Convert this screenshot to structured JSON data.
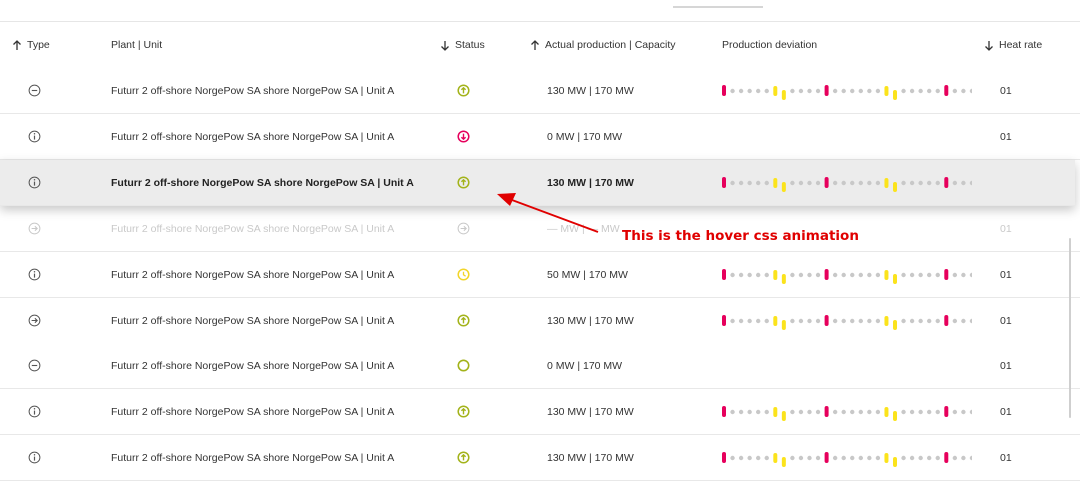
{
  "header": {
    "type": "Type",
    "plant_unit": "Plant | Unit",
    "status": "Status",
    "production": "Actual production | Capacity",
    "deviation": "Production deviation",
    "heat_rate": "Heat rate"
  },
  "rows": [
    {
      "type_icon": "minus-circle-icon",
      "plant": "Futurr 2 off-shore NorgePow SA shore NorgePow SA | Unit A",
      "status_icon": "arrow-up-circle-icon",
      "status_color": "#a3b31a",
      "production": "130 MW | 170 MW",
      "deviation": true,
      "heat_rate": "01"
    },
    {
      "type_icon": "info-circle-icon",
      "plant": "Futurr 2 off-shore NorgePow SA shore NorgePow SA | Unit A",
      "status_icon": "arrow-down-circle-icon",
      "status_color": "#e6005c",
      "production": "0 MW | 170 MW",
      "deviation": false,
      "heat_rate": "01"
    },
    {
      "type_icon": "info-circle-icon",
      "plant": "Futurr 2 off-shore NorgePow SA shore NorgePow SA | Unit A",
      "status_icon": "arrow-up-circle-icon",
      "status_color": "#a3b31a",
      "production": "130 MW | 170 MW",
      "deviation": true,
      "heat_rate": ""
    },
    {
      "type_icon": "arrow-right-circle-icon",
      "plant": "Futurr 2 off-shore NorgePow SA shore NorgePow SA | Unit A",
      "status_icon": "arrow-right-circle-icon",
      "status_color": "#c9c9c9",
      "production": "— MW | — MW",
      "deviation": false,
      "heat_rate": "01"
    },
    {
      "type_icon": "info-circle-icon",
      "plant": "Futurr 2 off-shore NorgePow SA shore NorgePow SA | Unit A",
      "status_icon": "clock-circle-icon",
      "status_color": "#f2d52a",
      "production": "50 MW | 170 MW",
      "deviation": true,
      "heat_rate": "01"
    },
    {
      "type_icon": "arrow-right-circle-icon",
      "plant": "Futurr 2 off-shore NorgePow SA shore NorgePow SA | Unit A",
      "status_icon": "arrow-up-circle-icon",
      "status_color": "#a3b31a",
      "production": "130 MW | 170 MW",
      "deviation": true,
      "heat_rate": "01"
    },
    {
      "type_icon": "minus-circle-icon",
      "plant": "Futurr 2 off-shore NorgePow SA shore NorgePow SA | Unit A",
      "status_icon": "empty-circle-icon",
      "status_color": "#a3b31a",
      "production": "0 MW | 170 MW",
      "deviation": false,
      "heat_rate": "01"
    },
    {
      "type_icon": "info-circle-icon",
      "plant": "Futurr 2 off-shore NorgePow SA shore NorgePow SA | Unit A",
      "status_icon": "arrow-up-circle-icon",
      "status_color": "#a3b31a",
      "production": "130 MW | 170 MW",
      "deviation": true,
      "heat_rate": "01"
    },
    {
      "type_icon": "info-circle-icon",
      "plant": "Futurr 2 off-shore NorgePow SA shore NorgePow SA | Unit A",
      "status_icon": "arrow-up-circle-icon",
      "status_color": "#a3b31a",
      "production": "130 MW | 170 MW",
      "deviation": true,
      "heat_rate": "01"
    }
  ],
  "deviation_pattern": [
    "pink",
    "grey",
    "grey",
    "grey",
    "grey",
    "grey",
    "yellow",
    "yellow",
    "grey",
    "grey",
    "grey",
    "grey",
    "pink",
    "grey",
    "grey",
    "grey",
    "grey",
    "grey",
    "grey",
    "yellow",
    "yellow",
    "grey",
    "grey",
    "grey",
    "grey",
    "grey",
    "pink",
    "grey",
    "grey",
    "grey"
  ],
  "colors": {
    "pink": "#e6005c",
    "yellow": "#fbe31c",
    "grey": "#c8c8c8",
    "annotation": "#e00000"
  },
  "annotation": {
    "text": "This is the hover css animation"
  }
}
